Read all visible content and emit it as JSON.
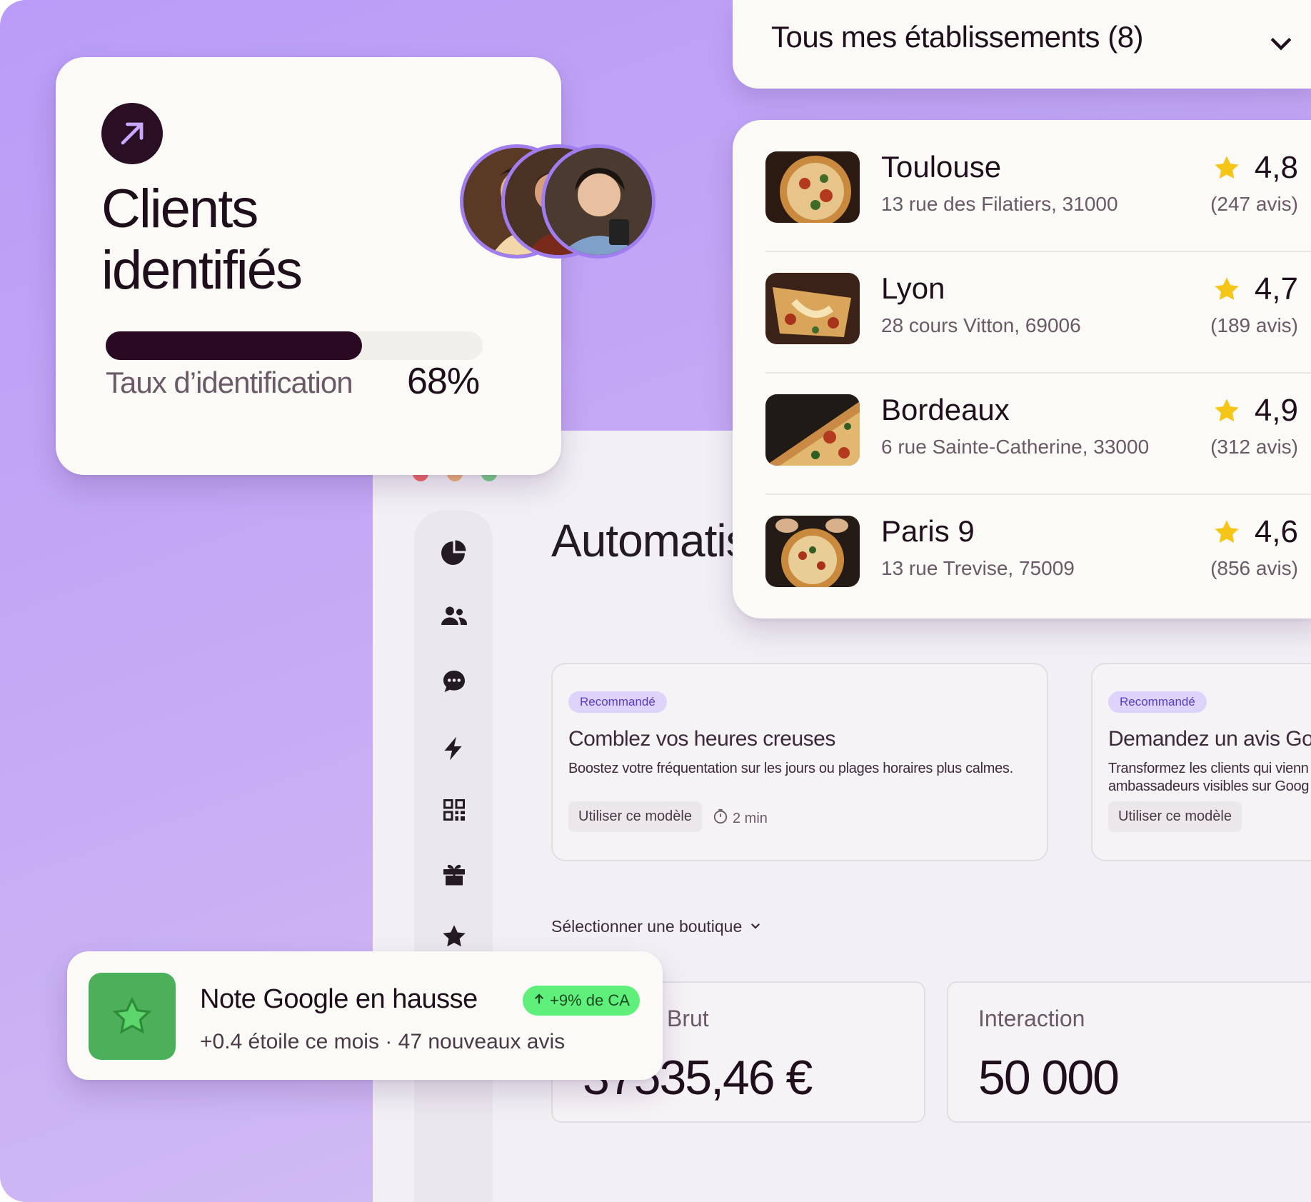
{
  "colors": {
    "background_purple": "#b99cf7",
    "dark_plum": "#2a0a22",
    "star_yellow": "#f5c518",
    "badge_purple_bg": "#ddd3fb",
    "chip_green": "#5ef07a",
    "note_icon_green": "#4caf5a"
  },
  "clients_card": {
    "icon": "arrow-up-right-icon",
    "title_line1": "Clients",
    "title_line2": "identifiés",
    "rate_label": "Taux d’identification",
    "rate_value": "68%",
    "rate_fraction": 0.68
  },
  "establishments": {
    "selector_label": "Tous mes établissements (8)",
    "locations": [
      {
        "name": "Toulouse",
        "address": "13 rue des Filatiers, 31000",
        "rating": "4,8",
        "reviews": "(247 avis)"
      },
      {
        "name": "Lyon",
        "address": "28 cours Vitton, 69006",
        "rating": "4,7",
        "reviews": "(189 avis)"
      },
      {
        "name": "Bordeaux",
        "address": "6 rue Sainte-Catherine, 33000",
        "rating": "4,9",
        "reviews": "(312 avis)"
      },
      {
        "name": "Paris 9",
        "address": "13 rue Trevise, 75009",
        "rating": "4,6",
        "reviews": "(856 avis)"
      }
    ]
  },
  "sidebar": {
    "icons": [
      "pie-chart-icon",
      "users-icon",
      "chat-icon",
      "lightning-icon",
      "qr-code-icon",
      "gift-icon",
      "star-icon"
    ]
  },
  "main": {
    "heading": "Automatis",
    "recommendations": [
      {
        "badge": "Recommandé",
        "title": "Comblez vos heures creuses",
        "description": "Boostez votre fréquentation sur les jours ou plages horaires plus calmes.",
        "button": "Utiliser ce modèle",
        "time": "2 min"
      },
      {
        "badge": "Recommandé",
        "title": "Demandez un avis Go",
        "description_line1": "Transformez les clients qui vienn",
        "description_line2": "ambassadeurs visibles sur Goog",
        "button": "Utiliser ce modèle"
      }
    ],
    "shop_selector": "Sélectionner une boutique",
    "stats": [
      {
        "label": "Brut",
        "value": "37535,46 €"
      },
      {
        "label": "Interaction",
        "value": "50 000"
      }
    ]
  },
  "google_note": {
    "title": "Note Google en hausse",
    "chip": "+9% de CA",
    "subtitle": "+0.4 étoile ce mois · 47 nouveaux avis"
  }
}
